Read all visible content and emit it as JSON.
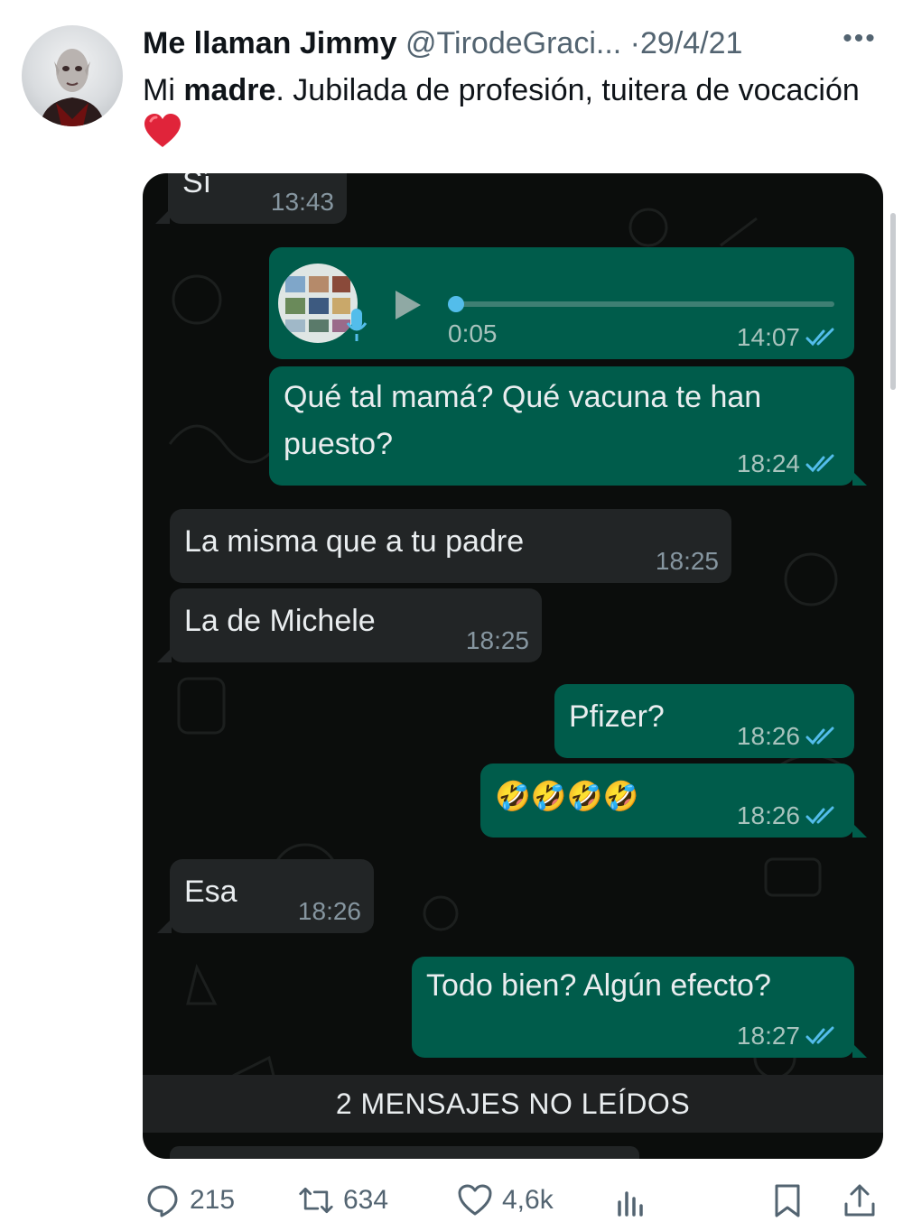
{
  "tweet": {
    "author_name": "Me llaman Jimmy",
    "author_handle": "@TirodeGraci...",
    "separator": "·",
    "date": "29/4/21",
    "more_label": "•••",
    "text_prefix": "Mi ",
    "text_bold": "madre",
    "text_rest": ". Jubilada de profesión, tuitera de vocación",
    "emoji": "❤️"
  },
  "chat": {
    "messages": [
      {
        "direction": "in",
        "text": "Sí",
        "time": "13:43"
      },
      {
        "direction": "out",
        "type": "voice",
        "duration": "0:05",
        "time": "14:07",
        "read": true
      },
      {
        "direction": "out",
        "text_line1": "Qué tal mamá? Qué vacuna te han",
        "text_line2": "puesto?",
        "time": "18:24",
        "read": true
      },
      {
        "direction": "in",
        "text": "La misma que a tu padre",
        "time": "18:25"
      },
      {
        "direction": "in",
        "text": "La de Michele",
        "time": "18:25"
      },
      {
        "direction": "out",
        "text": "Pfizer?",
        "time": "18:26",
        "read": true
      },
      {
        "direction": "out",
        "text": "🤣🤣🤣🤣",
        "time": "18:26",
        "read": true
      },
      {
        "direction": "in",
        "text": "Esa",
        "time": "18:26"
      },
      {
        "direction": "out",
        "text": "Todo bien? Algún efecto?",
        "time": "18:27",
        "read": true
      }
    ],
    "unread_label": "2 MENSAJES NO LEÍDOS",
    "colors": {
      "incoming": "#222526",
      "outgoing": "#005c4b",
      "read_ticks": "#53bdeb",
      "background": "#0b0d0c"
    }
  },
  "actions": {
    "replies": "215",
    "retweets": "634",
    "likes": "4,6k"
  }
}
